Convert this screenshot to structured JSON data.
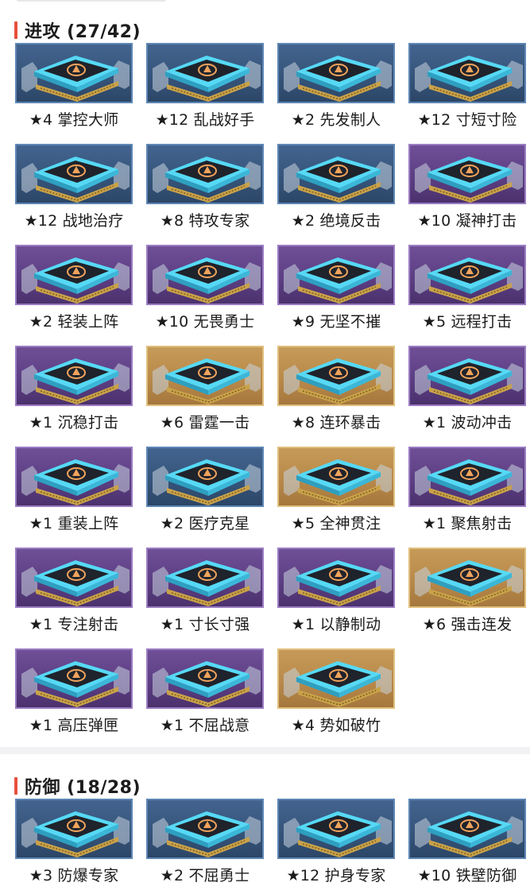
{
  "sections": [
    {
      "title": "进攻 (27/42)",
      "cards": [
        {
          "label": "★4 掌控大师",
          "tier": "blue",
          "icon": "flame-fist-icon"
        },
        {
          "label": "★12 乱战好手",
          "tier": "blue",
          "icon": "swirl-icon"
        },
        {
          "label": "★2 先发制人",
          "tier": "blue",
          "icon": "lightning-icon"
        },
        {
          "label": "★12 寸短寸险",
          "tier": "blue",
          "icon": "dagger-icon"
        },
        {
          "label": "★12 战地治疗",
          "tier": "blue",
          "icon": "medkit-icon"
        },
        {
          "label": "★8 特攻专家",
          "tier": "blue",
          "icon": "arrows-up-icon"
        },
        {
          "label": "★2 绝境反击",
          "tier": "blue",
          "icon": "counter-cycle-icon"
        },
        {
          "label": "★10 凝神打击",
          "tier": "purple",
          "icon": "flex-arm-icon"
        },
        {
          "label": "★2 轻装上阵",
          "tier": "purple",
          "icon": "wing-icon"
        },
        {
          "label": "★10 无畏勇士",
          "tier": "purple",
          "icon": "fist-icon"
        },
        {
          "label": "★9 无坚不摧",
          "tier": "purple",
          "icon": "hammer-icon"
        },
        {
          "label": "★5 远程打击",
          "tier": "purple",
          "icon": "bullet-icon"
        },
        {
          "label": "★1 沉稳打击",
          "tier": "purple",
          "icon": "person-shield-icon"
        },
        {
          "label": "★6 雷霆一击",
          "tier": "gold",
          "icon": "thunder-head-icon"
        },
        {
          "label": "★8 连环暴击",
          "tier": "gold",
          "icon": "chain-icon"
        },
        {
          "label": "★1 波动冲击",
          "tier": "purple",
          "icon": "wave-blade-icon"
        },
        {
          "label": "★1 重装上阵",
          "tier": "purple",
          "icon": "armor-boot-icon"
        },
        {
          "label": "★2 医疗克星",
          "tier": "blue",
          "icon": "broken-heart-icon"
        },
        {
          "label": "★5 全神贯注",
          "tier": "gold",
          "icon": "focus-head-icon"
        },
        {
          "label": "★1 聚焦射击",
          "tier": "purple",
          "icon": "crosshair-icon"
        },
        {
          "label": "★1 专注射击",
          "tier": "purple",
          "icon": "bullet-stream-icon"
        },
        {
          "label": "★1 寸长寸强",
          "tier": "purple",
          "icon": "blade-sweep-icon"
        },
        {
          "label": "★1 以静制动",
          "tier": "purple",
          "icon": "target-icon"
        },
        {
          "label": "★6 强击连发",
          "tier": "gold",
          "icon": "rapid-fire-icon"
        },
        {
          "label": "★1 高压弹匣",
          "tier": "purple",
          "icon": "magazine-icon"
        },
        {
          "label": "★1 不屈战意",
          "tier": "purple",
          "icon": "fist-raise-icon"
        },
        {
          "label": "★4 势如破竹",
          "tier": "gold",
          "icon": "break-through-icon"
        }
      ]
    },
    {
      "title": "防御 (18/28)",
      "cards": [
        {
          "label": "★3 防爆专家",
          "tier": "blue",
          "icon": "blast-shield-icon"
        },
        {
          "label": "★2 不屈勇士",
          "tier": "blue",
          "icon": "heart-ring-icon"
        },
        {
          "label": "★12 护身专家",
          "tier": "blue",
          "icon": "heart-shield-icon"
        },
        {
          "label": "★10 铁壁防御",
          "tier": "blue",
          "icon": "iron-wall-icon"
        }
      ]
    }
  ],
  "colors": {
    "accent": "#e8503a",
    "tier_blue": "#3b5b85",
    "tier_purple": "#614289",
    "tier_gold": "#bb8c4c",
    "chip_cyan": "#56d9f5",
    "chip_orange": "#f0a35c"
  }
}
